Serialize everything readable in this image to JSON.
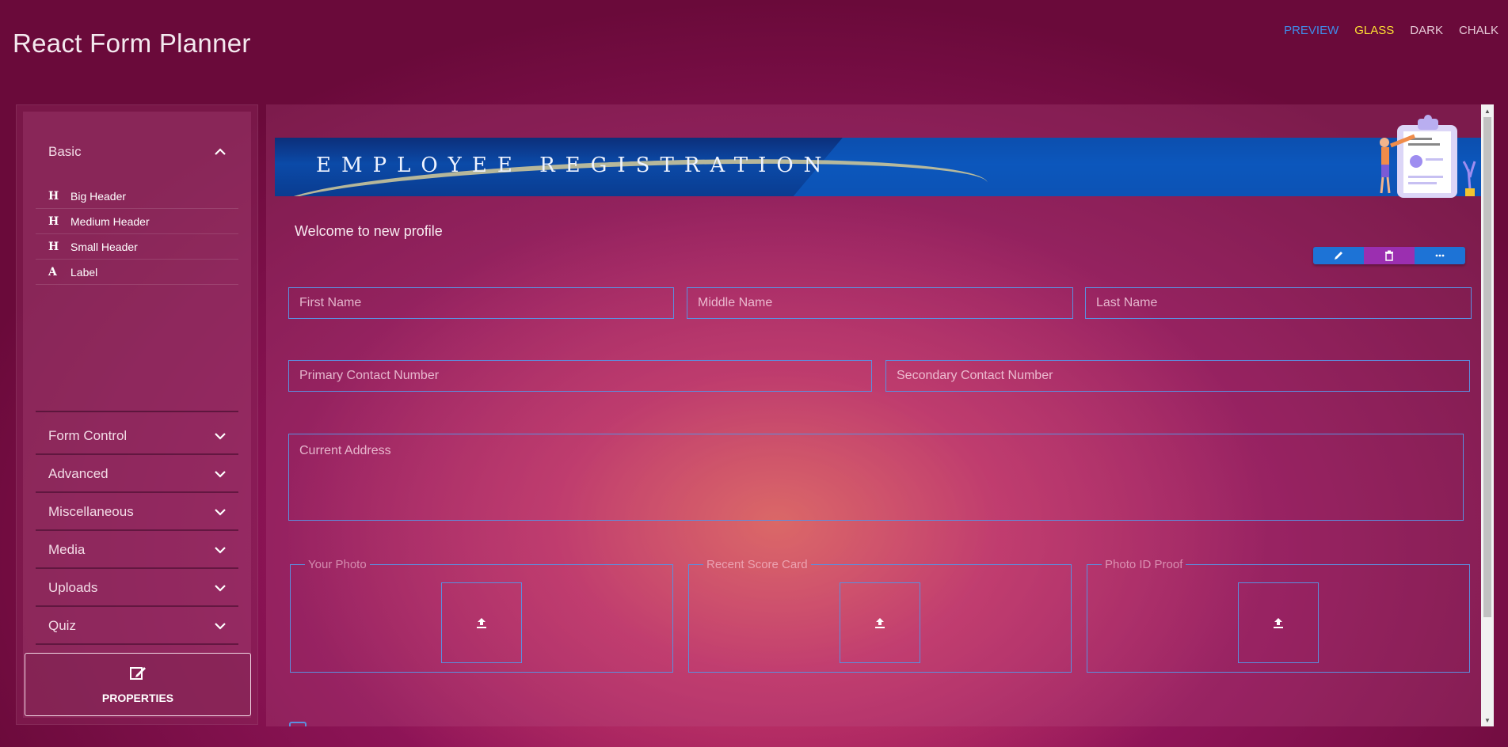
{
  "app": {
    "title": "React Form Planner"
  },
  "themes": [
    "PREVIEW",
    "GLASS",
    "DARK",
    "CHALK"
  ],
  "sidebar": {
    "basic": {
      "label": "Basic",
      "items": [
        {
          "icon": "H",
          "label": "Big Header"
        },
        {
          "icon": "H",
          "label": "Medium Header"
        },
        {
          "icon": "H",
          "label": "Small Header"
        },
        {
          "icon": "A",
          "label": "Label"
        }
      ]
    },
    "sections": [
      "Form Control",
      "Advanced",
      "Miscellaneous",
      "Media",
      "Uploads",
      "Quiz"
    ],
    "properties_label": "PROPERTIES"
  },
  "form": {
    "banner_title": "EMPLOYEE REGISTRATION",
    "welcome": "Welcome to new profile",
    "placeholders": {
      "first_name": "First Name",
      "middle_name": "Middle Name",
      "last_name": "Last Name",
      "primary_contact": "Primary Contact Number",
      "secondary_contact": "Secondary Contact Number",
      "current_address": "Current Address"
    },
    "uploads": [
      "Your Photo",
      "Recent Score Card",
      "Photo ID Proof"
    ]
  },
  "colors": {
    "accent_blue": "#1d73d6",
    "delete_purple": "#9b2fb0",
    "active_theme": "#ffe033",
    "preview_link": "#3f8be8",
    "field_border": "#5b8fe0"
  },
  "icons": {
    "toolbar": [
      "pencil-icon",
      "trash-icon",
      "more-icon"
    ],
    "upload": "upload-icon",
    "properties": "edit-icon"
  }
}
